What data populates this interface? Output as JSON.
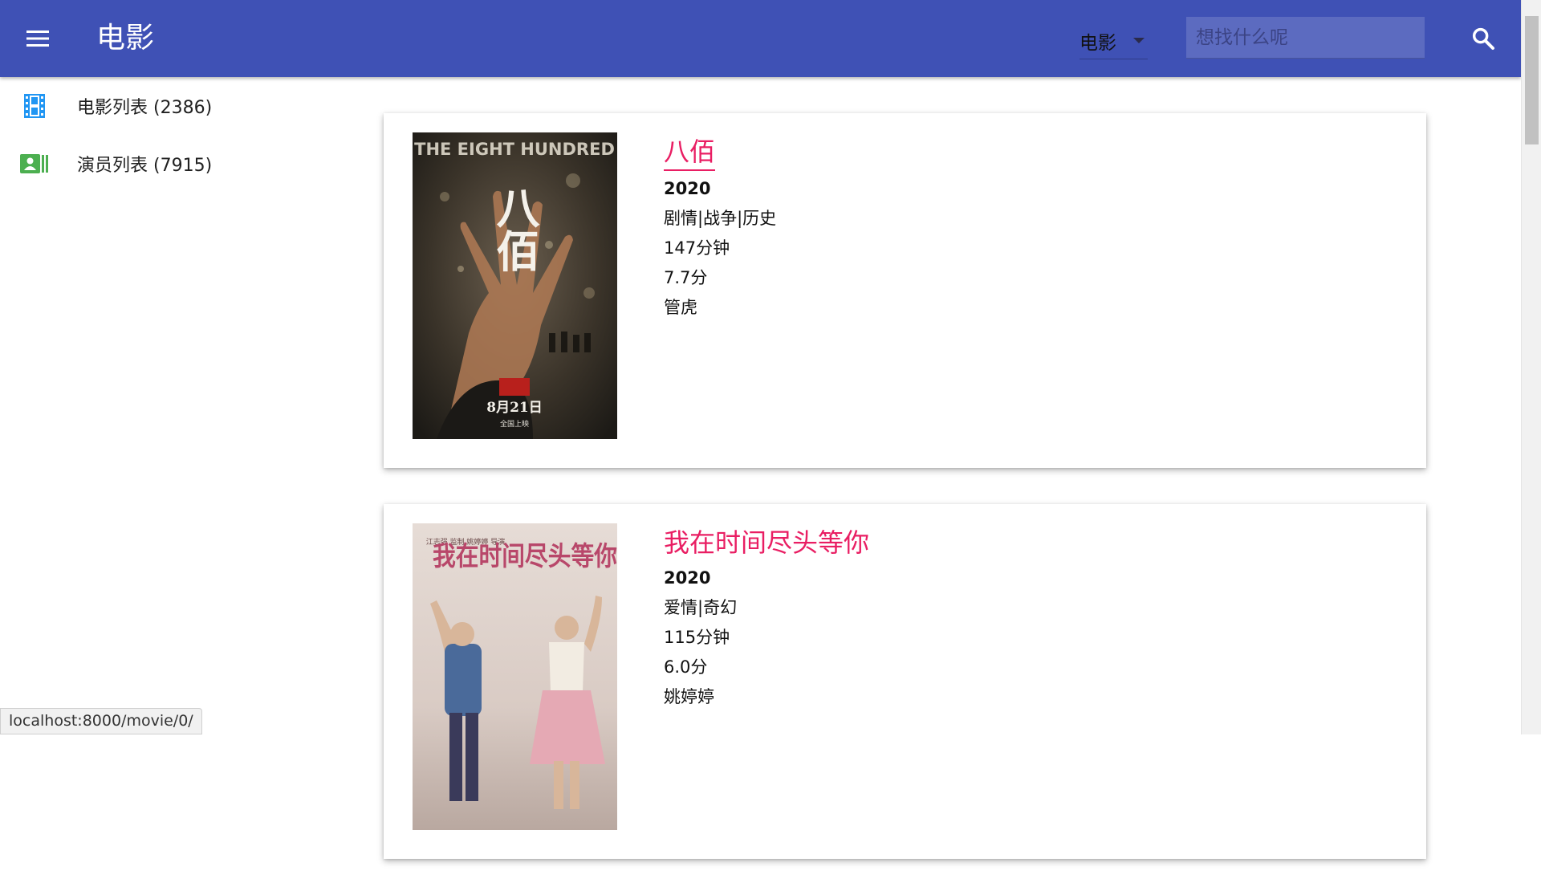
{
  "appbar": {
    "title": "电影",
    "menu_icon": "menu-icon",
    "type_select": {
      "selected": "电影"
    },
    "search": {
      "placeholder": "想找什么呢",
      "value": ""
    },
    "search_icon": "search-icon",
    "background": "#3f51b5"
  },
  "sidebar": {
    "items": [
      {
        "label": "电影列表 (2386)",
        "icon": "movie-film-icon",
        "color": "#2196f3"
      },
      {
        "label": "演员列表 (7915)",
        "icon": "contacts-card-icon",
        "color": "#4caf50"
      }
    ]
  },
  "movies": [
    {
      "title": "八佰",
      "year": "2020",
      "genres": "剧情|战争|历史",
      "duration": "147分钟",
      "rating": "7.7分",
      "director": "管虎",
      "poster": {
        "heading": "THE EIGHT HUNDRED",
        "title_art": "八佰",
        "date": "8月21日",
        "subtitle": "全国上映"
      }
    },
    {
      "title": "我在时间尽头等你",
      "year": "2020",
      "genres": "爱情|奇幻",
      "duration": "115分钟",
      "rating": "6.0分",
      "director": "姚婷婷",
      "poster": {
        "title_art": "我在时间尽头等你",
        "credits": "江志强 监制 姚婷婷 导演"
      }
    }
  ],
  "status_bar": {
    "url": "localhost:8000/movie/0/"
  },
  "colors": {
    "accent": "#e91e63",
    "primary": "#3f51b5"
  }
}
